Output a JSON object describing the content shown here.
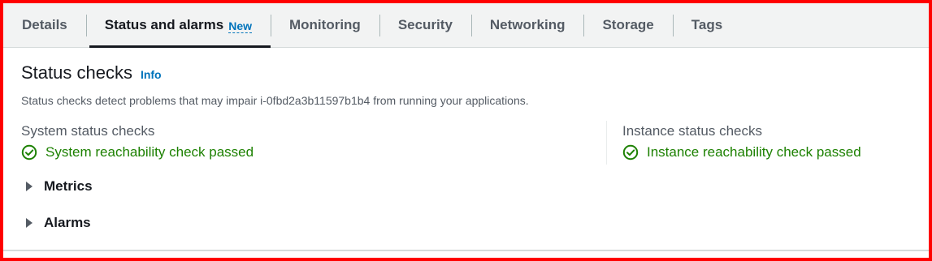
{
  "tabs": [
    {
      "label": "Details"
    },
    {
      "label": "Status and alarms",
      "badge": "New"
    },
    {
      "label": "Monitoring"
    },
    {
      "label": "Security"
    },
    {
      "label": "Networking"
    },
    {
      "label": "Storage"
    },
    {
      "label": "Tags"
    }
  ],
  "section": {
    "title": "Status checks",
    "info_link": "Info",
    "description": "Status checks detect problems that may impair i-0fbd2a3b11597b1b4 from running your applications."
  },
  "system": {
    "label": "System status checks",
    "status": "System reachability check passed"
  },
  "instance": {
    "label": "Instance status checks",
    "status": "Instance reachability check passed"
  },
  "expanders": {
    "metrics": "Metrics",
    "alarms": "Alarms"
  },
  "colors": {
    "success": "#1d8102",
    "link": "#0073bb",
    "highlight_border": "#ff0000"
  },
  "icons": {
    "status": "check-circle-icon",
    "expander": "caret-right-icon"
  }
}
